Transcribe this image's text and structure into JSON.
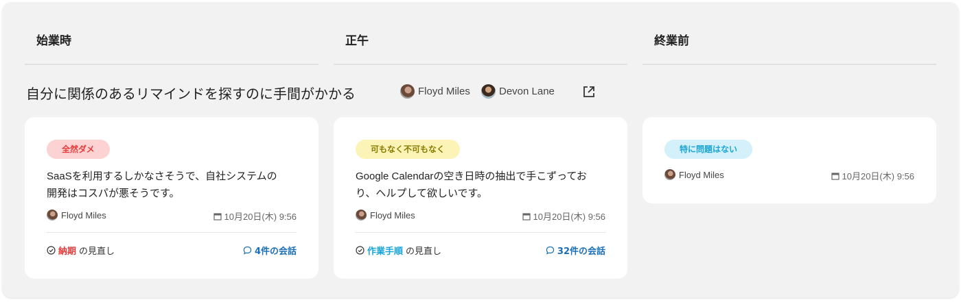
{
  "columns": [
    {
      "title": "始業時"
    },
    {
      "title": "正午"
    },
    {
      "title": "終業前"
    }
  ],
  "topic": {
    "title": "自分に関係のあるリマインドを探すのに手間がかかる",
    "assignees": [
      "Floyd Miles",
      "Devon Lane"
    ],
    "open_icon": "external-link-icon"
  },
  "cards": [
    {
      "badge": "全然ダメ",
      "badge_color": "#fcd2d2",
      "body_line1": "SaaSを利用するしかなさそうで、自社システムの",
      "body_line2": "開発はコスパが悪そうです。",
      "author": "Floyd Miles",
      "date": "10月20日(木) 9:56",
      "review_keyword": "納期",
      "review_suffix": "の見直し",
      "comments": "4件の会話"
    },
    {
      "badge": "可もなく不可もなく",
      "badge_color": "#fbf4b6",
      "body_line1": "Google Calendarの空き日時の抽出で手こずってお",
      "body_line2": "り、ヘルプして欲しいです。",
      "author": "Floyd Miles",
      "date": "10月20日(木) 9:56",
      "review_keyword": "作業手順",
      "review_suffix": "の見直し",
      "comments": "32件の会話"
    },
    {
      "badge": "特に問題はない",
      "badge_color": "#d4f0fb",
      "author": "Floyd Miles",
      "date": "10月20日(木) 9:56"
    }
  ],
  "colors": {
    "board_bg": "#f2f2f2",
    "accent_link": "#1b6fb8",
    "keyword_red": "#e53a3a",
    "keyword_cyan": "#1aa5d6"
  }
}
